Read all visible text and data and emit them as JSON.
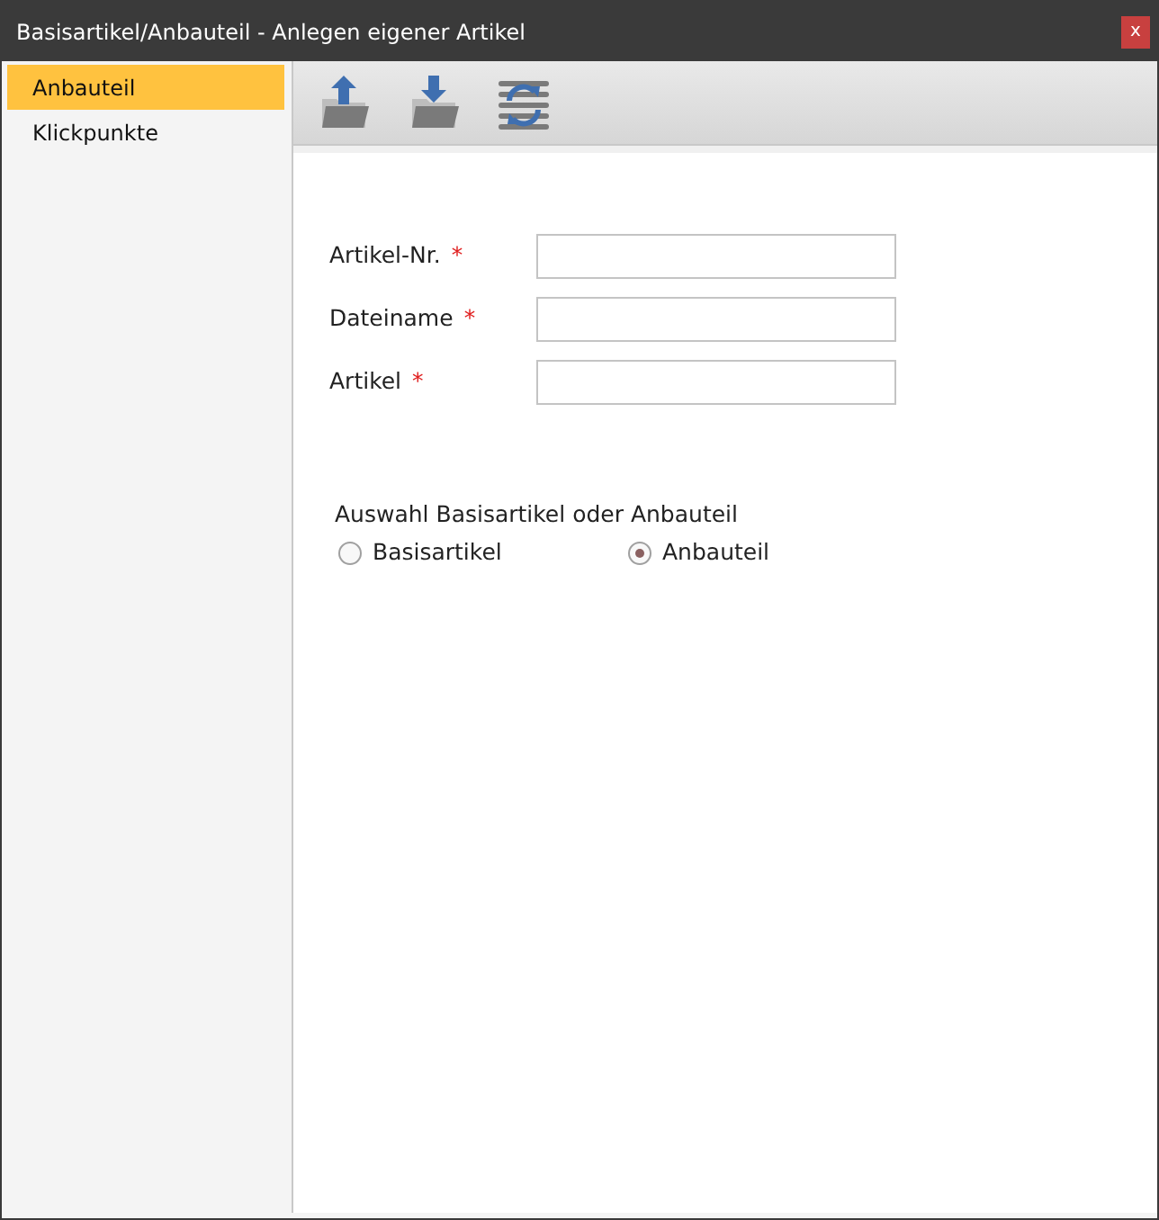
{
  "window": {
    "title": "Basisartikel/Anbauteil - Anlegen eigener Artikel",
    "close": "x"
  },
  "sidebar": {
    "items": [
      {
        "label": "Anbauteil",
        "selected": true
      },
      {
        "label": "Klickpunkte",
        "selected": false
      }
    ]
  },
  "toolbar": {
    "buttons": [
      {
        "kind": "upload"
      },
      {
        "kind": "download"
      },
      {
        "kind": "sync"
      }
    ]
  },
  "form": {
    "fields": [
      {
        "label": "Artikel-Nr.",
        "required": "*"
      },
      {
        "label": "Dateiname",
        "required": "*"
      },
      {
        "label": "Artikel",
        "required": "*"
      }
    ],
    "choice": {
      "label": "Auswahl Basisartikel oder Anbauteil",
      "options": [
        {
          "label": "Basisartikel",
          "selected": false
        },
        {
          "label": "Anbauteil",
          "selected": true
        }
      ]
    }
  }
}
